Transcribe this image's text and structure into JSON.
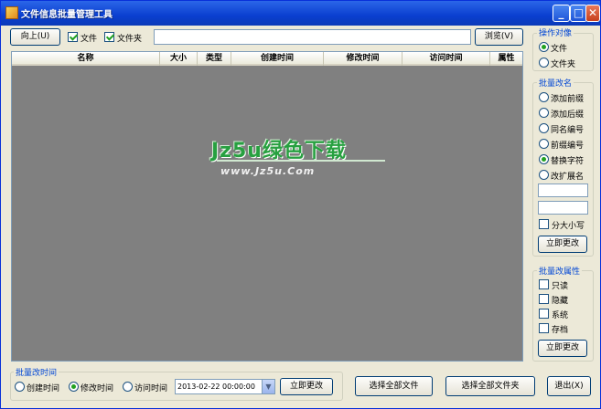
{
  "window": {
    "title": "文件信息批量管理工具",
    "minimize": "_",
    "maximize": "□",
    "close": "✕"
  },
  "toolbar": {
    "up_button": "向上(U)",
    "file_checkbox": {
      "label": "文件",
      "checked": true
    },
    "folder_checkbox": {
      "label": "文件夹",
      "checked": true
    },
    "path_value": "",
    "browse_button": "浏览(V)"
  },
  "list": {
    "columns": [
      "名称",
      "大小",
      "类型",
      "创建时间",
      "修改时间",
      "访问时间",
      "属性"
    ],
    "watermark": {
      "line1": "Jz5u绿色下载",
      "line2": "www.Jz5u.Com"
    }
  },
  "operation_target": {
    "title": "操作对像",
    "options": [
      {
        "label": "文件",
        "selected": true
      },
      {
        "label": "文件夹",
        "selected": false
      }
    ]
  },
  "batch_rename": {
    "title": "批量改名",
    "options": [
      {
        "label": "添加前缀",
        "selected": false
      },
      {
        "label": "添加后缀",
        "selected": false
      },
      {
        "label": "同名编号",
        "selected": false
      },
      {
        "label": "前缀编号",
        "selected": false
      },
      {
        "label": "替换字符",
        "selected": true
      },
      {
        "label": "改扩展名",
        "selected": false
      }
    ],
    "input1": "",
    "input2": "",
    "case_checkbox": {
      "label": "分大小写",
      "checked": false
    },
    "apply_button": "立即更改"
  },
  "batch_attributes": {
    "title": "批量改属性",
    "options": [
      {
        "label": "只读",
        "checked": false
      },
      {
        "label": "隐藏",
        "checked": false
      },
      {
        "label": "系统",
        "checked": false
      },
      {
        "label": "存档",
        "checked": false
      }
    ],
    "apply_button": "立即更改"
  },
  "batch_time": {
    "title": "批量改时间",
    "options": [
      {
        "label": "创建时间",
        "selected": false
      },
      {
        "label": "修改时间",
        "selected": true
      },
      {
        "label": "访问时间",
        "selected": false
      }
    ],
    "datetime_value": "2013-02-22 00:00:00",
    "apply_button": "立即更改"
  },
  "bottom_buttons": {
    "select_all_files": "选择全部文件",
    "select_all_folders": "选择全部文件夹",
    "exit": "退出(X)"
  }
}
